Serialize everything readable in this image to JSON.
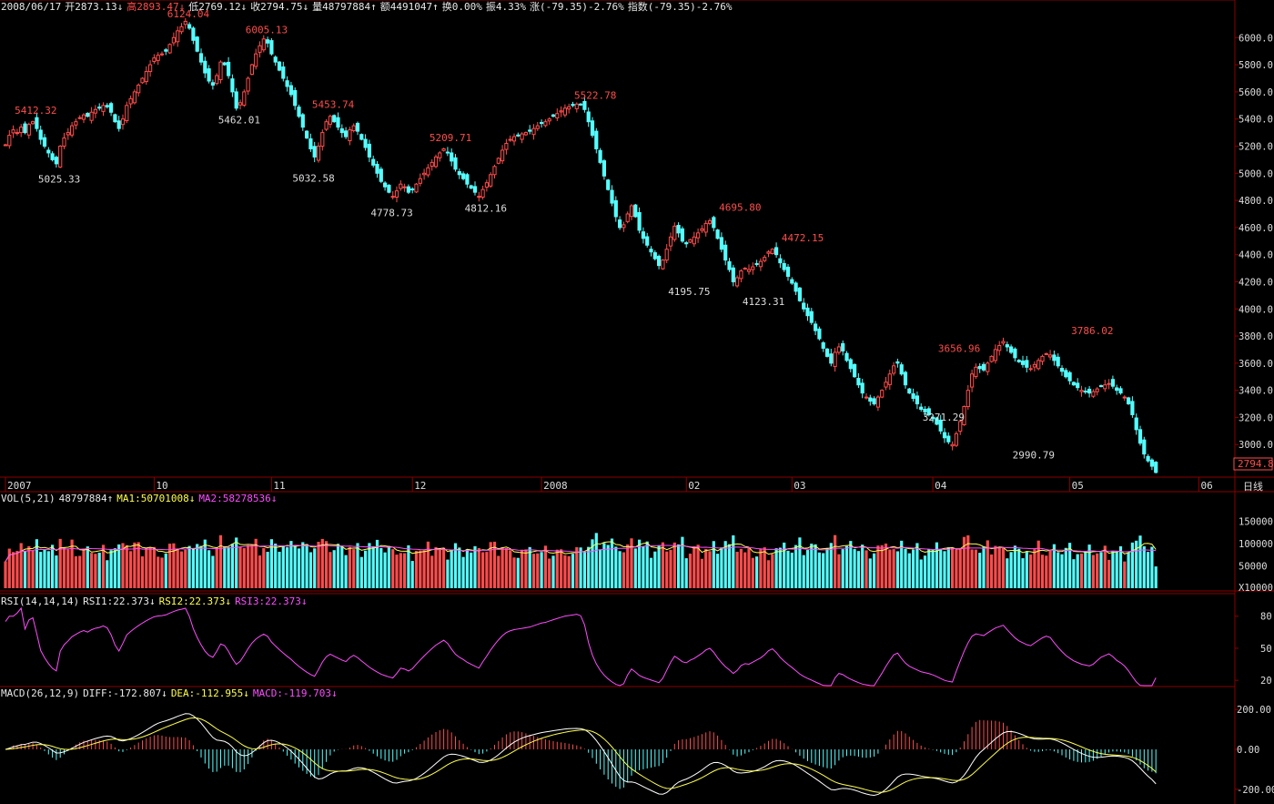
{
  "header": {
    "date": "2008/06/17",
    "open": "开2873.13↓",
    "high": "高2893.47↓",
    "low": "低2769.12↓",
    "close": "收2794.75↓",
    "volume": "量48797884↑",
    "amount": "额4491047↑",
    "turnover": "换0.00%",
    "amplitude": "振4.33%",
    "change": "涨(-79.35)-2.76%",
    "index_change": "指数(-79.35)-2.76%"
  },
  "vol_header": {
    "name": "VOL(5,21)",
    "value": "48797884↑",
    "ma1": "MA1:50701008↓",
    "ma2": "MA2:58278536↓"
  },
  "rsi_header": {
    "name": "RSI(14,14,14)",
    "rsi1": "RSI1:22.373↓",
    "rsi2": "RSI2:22.373↓",
    "rsi3": "RSI3:22.373↓"
  },
  "macd_header": {
    "name": "MACD(26,12,9)",
    "diff": "DIFF:-172.807↓",
    "dea": "DEA:-112.955↓",
    "macd": "MACD:-119.703↓"
  },
  "period_label": "日线",
  "last_price": "2794.8",
  "colors": {
    "up": "#ff4c4c",
    "down": "#55ffff",
    "ma1": "#ffff4c",
    "ma2": "#ff4cff",
    "grid": "#8b0000"
  },
  "chart_data": {
    "type": "candlestick",
    "price_axis": {
      "ticks": [
        "6000.0",
        "5800.0",
        "5600.0",
        "5400.0",
        "5200.0",
        "5000.0",
        "4800.0",
        "4600.0",
        "4400.0",
        "4200.0",
        "4000.0",
        "3800.0",
        "3600.0",
        "3400.0",
        "3200.0",
        "3000.0"
      ],
      "ylim": [
        2780,
        6170
      ]
    },
    "time_axis": [
      {
        "label": "2007",
        "bar": 0
      },
      {
        "label": "10",
        "bar": 38
      },
      {
        "label": "11",
        "bar": 68
      },
      {
        "label": "12",
        "bar": 104
      },
      {
        "label": "2008",
        "bar": 137
      },
      {
        "label": "02",
        "bar": 174
      },
      {
        "label": "03",
        "bar": 201
      },
      {
        "label": "04",
        "bar": 237
      },
      {
        "label": "05",
        "bar": 272
      },
      {
        "label": "06",
        "bar": 305
      }
    ],
    "annotations": [
      {
        "text": "5412.32",
        "bar": 7,
        "price": 5412.32,
        "pos": "above"
      },
      {
        "text": "5025.33",
        "bar": 13,
        "price": 5025.33,
        "pos": "below"
      },
      {
        "text": "6124.04",
        "bar": 46,
        "price": 6124.04,
        "pos": "above"
      },
      {
        "text": "5462.01",
        "bar": 59,
        "price": 5462.01,
        "pos": "below"
      },
      {
        "text": "6005.13",
        "bar": 66,
        "price": 6005.13,
        "pos": "above"
      },
      {
        "text": "5453.74",
        "bar": 83,
        "price": 5453.74,
        "pos": "above"
      },
      {
        "text": "5032.58",
        "bar": 78,
        "price": 5032.58,
        "pos": "below"
      },
      {
        "text": "4778.73",
        "bar": 98,
        "price": 4778.73,
        "pos": "below"
      },
      {
        "text": "5209.71",
        "bar": 113,
        "price": 5209.71,
        "pos": "above"
      },
      {
        "text": "4812.16",
        "bar": 122,
        "price": 4812.16,
        "pos": "below"
      },
      {
        "text": "5522.78",
        "bar": 150,
        "price": 5522.78,
        "pos": "above"
      },
      {
        "text": "4195.75",
        "bar": 174,
        "price": 4195.75,
        "pos": "below"
      },
      {
        "text": "4695.80",
        "bar": 187,
        "price": 4695.8,
        "pos": "above"
      },
      {
        "text": "4123.31",
        "bar": 193,
        "price": 4123.31,
        "pos": "below"
      },
      {
        "text": "4472.15",
        "bar": 203,
        "price": 4472.15,
        "pos": "above"
      },
      {
        "text": "3656.96",
        "bar": 243,
        "price": 3656.96,
        "pos": "above"
      },
      {
        "text": "3271.29",
        "bar": 239,
        "price": 3271.29,
        "pos": "below"
      },
      {
        "text": "2990.79",
        "bar": 262,
        "price": 2990.79,
        "pos": "below"
      },
      {
        "text": "3786.02",
        "bar": 277,
        "price": 3786.02,
        "pos": "above"
      }
    ],
    "closes": [
      5210,
      5280,
      5320,
      5300,
      5340,
      5300,
      5360,
      5380,
      5330,
      5250,
      5200,
      5150,
      5100,
      5070,
      5200,
      5260,
      5300,
      5350,
      5380,
      5410,
      5430,
      5420,
      5450,
      5470,
      5480,
      5500,
      5490,
      5450,
      5380,
      5330,
      5400,
      5500,
      5550,
      5600,
      5650,
      5700,
      5750,
      5800,
      5850,
      5870,
      5880,
      5900,
      5950,
      6000,
      6050,
      6080,
      6120,
      6070,
      5980,
      5900,
      5820,
      5740,
      5680,
      5650,
      5720,
      5820,
      5800,
      5720,
      5600,
      5480,
      5520,
      5600,
      5700,
      5800,
      5880,
      5940,
      5990,
      5960,
      5880,
      5820,
      5760,
      5700,
      5640,
      5580,
      5500,
      5420,
      5340,
      5260,
      5180,
      5120,
      5200,
      5300,
      5380,
      5420,
      5380,
      5340,
      5300,
      5270,
      5320,
      5350,
      5310,
      5250,
      5190,
      5120,
      5060,
      5000,
      4940,
      4900,
      4860,
      4830,
      4870,
      4920,
      4900,
      4860,
      4880,
      4920,
      4960,
      5000,
      5040,
      5080,
      5120,
      5150,
      5180,
      5150,
      5090,
      5030,
      4990,
      4960,
      4920,
      4890,
      4860,
      4830,
      4880,
      4930,
      4990,
      5050,
      5110,
      5170,
      5220,
      5250,
      5270,
      5280,
      5290,
      5300,
      5310,
      5330,
      5350,
      5370,
      5380,
      5400,
      5420,
      5440,
      5460,
      5480,
      5490,
      5500,
      5510,
      5505,
      5470,
      5380,
      5280,
      5180,
      5080,
      4980,
      4880,
      4780,
      4680,
      4600,
      4620,
      4700,
      4760,
      4680,
      4580,
      4520,
      4470,
      4420,
      4370,
      4320,
      4360,
      4440,
      4530,
      4610,
      4560,
      4500,
      4480,
      4510,
      4530,
      4560,
      4590,
      4630,
      4650,
      4600,
      4520,
      4440,
      4360,
      4290,
      4200,
      4230,
      4280,
      4300,
      4290,
      4310,
      4330,
      4350,
      4380,
      4420,
      4440,
      4400,
      4340,
      4290,
      4240,
      4190,
      4130,
      4060,
      4000,
      3950,
      3900,
      3840,
      3780,
      3710,
      3650,
      3600,
      3680,
      3720,
      3690,
      3620,
      3560,
      3500,
      3440,
      3380,
      3350,
      3320,
      3300,
      3350,
      3400,
      3460,
      3520,
      3580,
      3600,
      3520,
      3440,
      3380,
      3340,
      3300,
      3260,
      3240,
      3220,
      3190,
      3150,
      3100,
      3050,
      3020,
      3000,
      3080,
      3170,
      3280,
      3400,
      3520,
      3570,
      3560,
      3550,
      3600,
      3650,
      3700,
      3730,
      3760,
      3720,
      3680,
      3640,
      3610,
      3590,
      3570,
      3560,
      3590,
      3620,
      3650,
      3670,
      3660,
      3620,
      3580,
      3540,
      3500,
      3470,
      3440,
      3420,
      3400,
      3390,
      3380,
      3390,
      3410,
      3430,
      3440,
      3450,
      3430,
      3400,
      3380,
      3350,
      3300,
      3220,
      3110,
      3010,
      2930,
      2880,
      2840,
      2794.75
    ],
    "volume_axis": {
      "ticks": [
        "150000",
        "100000",
        "50000"
      ],
      "unit": "X10000",
      "ylim": [
        0,
        190000
      ]
    },
    "rsi_axis": {
      "ticks": [
        "80",
        "50",
        "20"
      ],
      "ylim": [
        15,
        90
      ]
    },
    "macd_axis": {
      "ticks": [
        "200.00",
        "0.00",
        "-200.00"
      ],
      "ylim": [
        -260,
        260
      ]
    }
  }
}
